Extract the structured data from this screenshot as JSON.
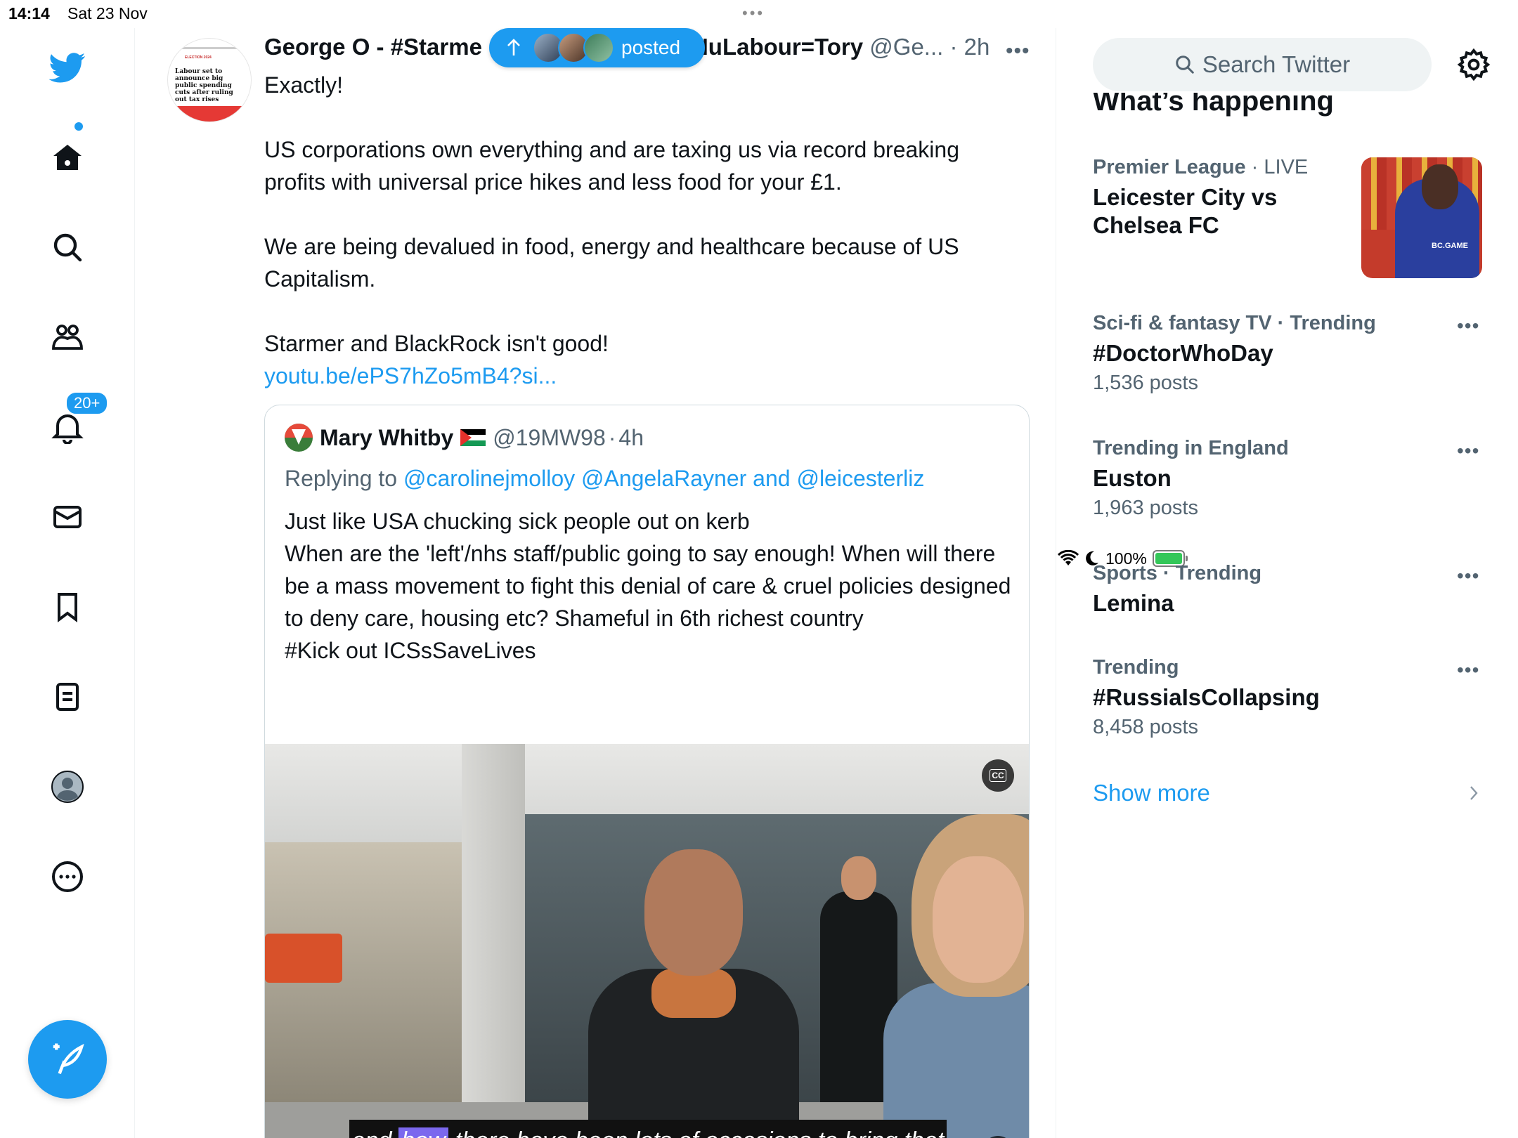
{
  "status_bar": {
    "time": "14:14",
    "date": "Sat 23 Nov",
    "battery": "100%"
  },
  "nav": {
    "notifications_badge": "20+",
    "items": [
      "twitter-logo",
      "home",
      "explore",
      "communities",
      "notifications",
      "messages",
      "bookmarks",
      "lists",
      "profile",
      "more"
    ],
    "accent": "#1d9bf0"
  },
  "new_posts_pill": {
    "label": "posted"
  },
  "tweet": {
    "display_name": "George O - #Starme",
    "display_name_tail": "NuLabour=Tory",
    "handle": "@Ge...",
    "separator": "·",
    "time": "2h",
    "line1": "Exactly!",
    "line2": "US corporations own everything and are taxing us via record breaking profits with universal price hikes and less food for your £1.",
    "line3": "We are being devalued in food, energy and healthcare because of US Capitalism.",
    "line4": "Starmer and BlackRock isn't good!",
    "link": "youtu.be/ePS7hZo5mB4?si...",
    "avatar": {
      "small_header": "ELECTION 2024",
      "headline": "Labour set to announce big public spending cuts after ruling out tax rises"
    }
  },
  "quote": {
    "display_name": "Mary Whitby",
    "handle": "@19MW98",
    "separator": "·",
    "time": "4h",
    "replying_prefix": "Replying to",
    "replying_1": "@carolinejmolloy",
    "replying_2": "@AngelaRayner",
    "replying_and": "and",
    "replying_3": "@leicesterliz",
    "text_1": "Just like USA chucking sick people out on kerb",
    "text_2": "When are the 'left'/nhs staff/public going to say enough! When will there be a mass movement to fight this denial of care & cruel policies designed to deny care, housing etc?  Shameful in 6th richest country",
    "text_3": "#Kick out ICSsSaveLives",
    "video": {
      "caption_before": "and",
      "caption_highlight": "how",
      "caption_after": "there have been lots of occasions to bring that",
      "cc_label": "CC"
    }
  },
  "sidebar": {
    "search_placeholder": "Search Twitter",
    "section_title": "What’s happening",
    "trends": [
      {
        "context": "Premier League",
        "context_suffix": " · LIVE",
        "title": "Leicester City vs Chelsea FC",
        "count": ""
      },
      {
        "context": "Sci-fi & fantasy TV · Trending",
        "context_suffix": "",
        "title": "#DoctorWhoDay",
        "count": "1,536 posts"
      },
      {
        "context": "Trending in England",
        "context_suffix": "",
        "title": "Euston",
        "count": "1,963 posts"
      },
      {
        "context": "Sports · Trending",
        "context_suffix": "",
        "title": "Lemina",
        "count": ""
      },
      {
        "context": "Trending",
        "context_suffix": "",
        "title": "#RussiaIsCollapsing",
        "count": "8,458 posts"
      }
    ],
    "show_more": "Show more",
    "trend_image_logo": "BC.GAME"
  }
}
